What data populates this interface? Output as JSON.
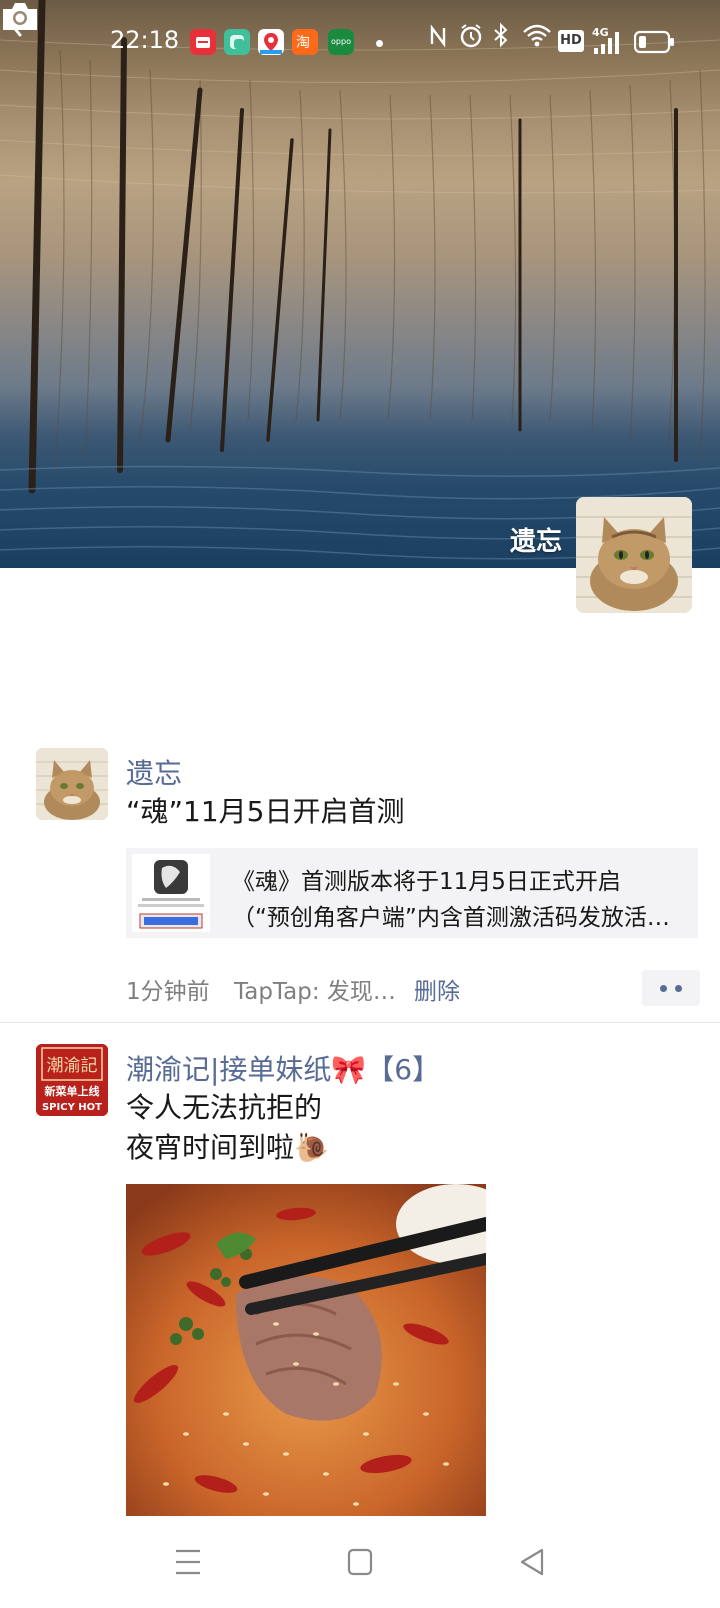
{
  "status_bar": {
    "time": "22:18",
    "app_icons": [
      "red-mail-icon",
      "green-app-icon",
      "map-icon",
      "taobao-icon",
      "oppo-icon"
    ],
    "oppo_label": "oppo",
    "right_icons": [
      "nfc-icon",
      "alarm-icon",
      "bluetooth-icon",
      "wifi-icon",
      "hd-icon",
      "4g-signal-icon",
      "battery-icon"
    ],
    "hd_label": "HD",
    "network_label": "4G"
  },
  "profile": {
    "name": "遗忘"
  },
  "posts": [
    {
      "author": "遗忘",
      "text": "“魂”11月5日开启首测",
      "link": {
        "title_line1": "《魂》首测版本将于11月5日正式开启",
        "title_line2": "（“预创角客户端”内含首测激活码发放活…"
      },
      "time": "1分钟前",
      "source": "TapTap: 发现…",
      "delete_label": "删除"
    },
    {
      "author": "潮渝记|接单妹纸🎀【6】",
      "logo_text_top": "潮渝記",
      "logo_text_mid": "新菜单上线",
      "logo_text_bottom": "SPICY HOT",
      "text_line1": "令人无法抗拒的",
      "text_line2": "夜宵时间到啦🐌"
    }
  ],
  "colors": {
    "link_blue": "#576b95",
    "text_dark": "#191919",
    "meta_gray": "#7f7f7f",
    "card_bg": "#f3f3f5"
  },
  "nav": {
    "buttons": [
      "menu-icon",
      "home-icon",
      "back-triangle-icon"
    ]
  }
}
